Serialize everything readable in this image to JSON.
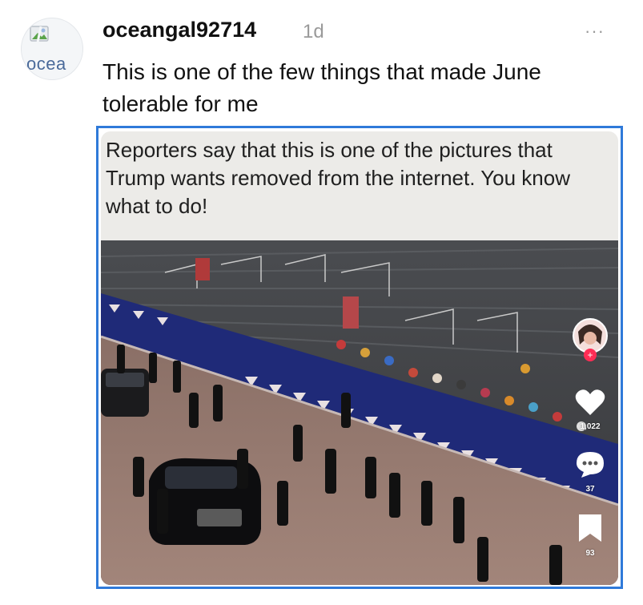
{
  "post": {
    "avatar_alt": "ocea",
    "username": "oceangal92714",
    "time": "1d",
    "more_label": "···",
    "text": "This is one of the few things that made June tolerable for me"
  },
  "media": {
    "caption": "Reporters say that this is one of the pictures that Trump wants removed from the internet. You know what to do!",
    "likes": "1,022",
    "comments": "37",
    "saves": "93",
    "follow_badge": "+"
  },
  "colors": {
    "frame_border": "#2f7ad9",
    "follow_badge": "#ff2d55"
  },
  "icons": {
    "avatar": "broken-image-icon",
    "like": "heart-icon",
    "comment": "comment-bubble-icon",
    "save": "bookmark-icon",
    "more": "more-options-icon"
  }
}
